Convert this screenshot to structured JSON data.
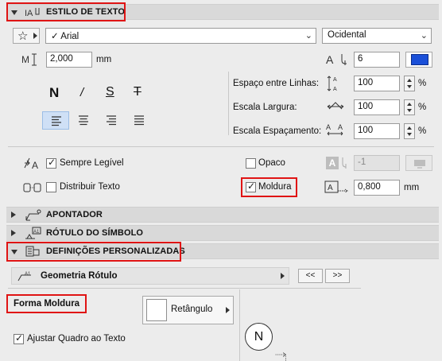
{
  "sections": {
    "text_style": {
      "title": "ESTILO DE TEXTO"
    },
    "pointer": {
      "title": "APONTADOR"
    },
    "symbol_label": {
      "title": "RÓTULO DO SÍMBOLO"
    },
    "custom_settings": {
      "title": "DEFINIÇÕES PERSONALIZADAS"
    }
  },
  "font": {
    "name": "Arial",
    "check": "✓",
    "script": "Ocidental"
  },
  "size": {
    "height": "2,000",
    "unit": "mm",
    "pen": "6"
  },
  "style_buttons": {
    "bold": "N",
    "italic": "/",
    "underline": "S",
    "strike": "T"
  },
  "spacing": {
    "line_label": "Espaço entre Linhas:",
    "line_value": "100",
    "width_label": "Escala Largura:",
    "width_value": "100",
    "char_label": "Escala Espaçamento:",
    "char_value": "100",
    "unit": "%"
  },
  "options": {
    "always_readable": "Sempre Legível",
    "distribute_text": "Distribuir Texto",
    "opaque": "Opaco",
    "frame": "Moldura",
    "bg_pen": "-1",
    "frame_offset": "0,800",
    "frame_unit": "mm"
  },
  "custom": {
    "geometry_label": "Geometria Rótulo",
    "prev": "<<",
    "next": ">>",
    "frame_shape_label": "Forma Moldura",
    "shape_value": "Retângulo",
    "fit_frame": "Ajustar Quadro ao Texto",
    "preview_letter": "N"
  },
  "colors": {
    "highlight": "#e01414",
    "accent_blue": "#1a4fd8",
    "selected_bg": "#cfe0f6"
  }
}
